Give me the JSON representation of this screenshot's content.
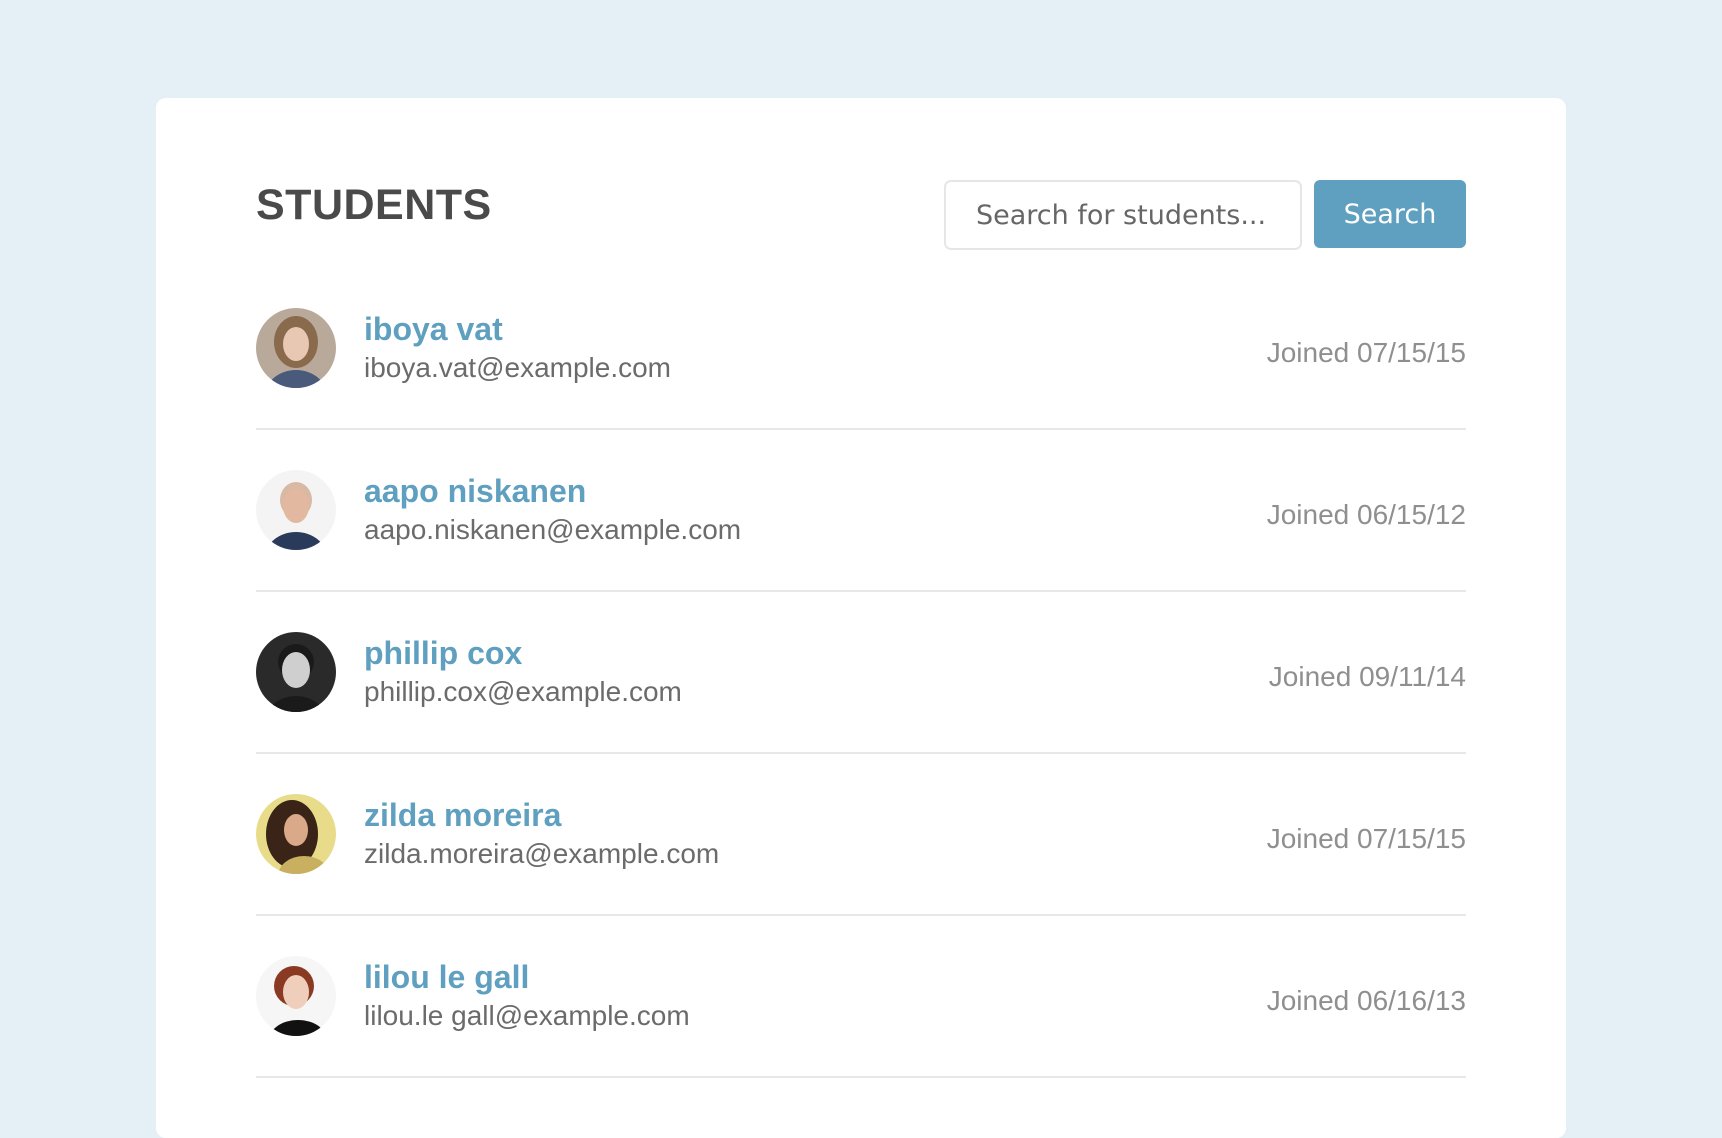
{
  "header": {
    "title": "STUDENTS",
    "search_placeholder": "Search for students...",
    "search_button_label": "Search"
  },
  "students": [
    {
      "name": "iboya vat",
      "email": "iboya.vat@example.com",
      "joined": "Joined 07/15/15",
      "avatar": {
        "bg": "#b9a99a",
        "skin": "#e8c8b2",
        "hair": "#8a6a4c",
        "shirt": "#4a5a7a"
      }
    },
    {
      "name": "aapo niskanen",
      "email": "aapo.niskanen@example.com",
      "joined": "Joined 06/15/12",
      "avatar": {
        "bg": "#f4f4f4",
        "skin": "#e2b9a0",
        "hair": "#d9b8a4",
        "shirt": "#2a3a5a"
      }
    },
    {
      "name": "phillip cox",
      "email": "phillip.cox@example.com",
      "joined": "Joined 09/11/14",
      "avatar": {
        "bg": "#2a2a2a",
        "skin": "#cfcfcf",
        "hair": "#1a1a1a",
        "shirt": "#1a1a1a"
      }
    },
    {
      "name": "zilda moreira",
      "email": "zilda.moreira@example.com",
      "joined": "Joined 07/15/15",
      "avatar": {
        "bg": "#e8dc8a",
        "skin": "#d9a98a",
        "hair": "#3a2418",
        "shirt": "#c8b060"
      }
    },
    {
      "name": "lilou le gall",
      "email": "lilou.le gall@example.com",
      "joined": "Joined 06/16/13",
      "avatar": {
        "bg": "#f6f6f6",
        "skin": "#efcfbc",
        "hair": "#8a3a22",
        "shirt": "#111111"
      }
    }
  ],
  "colors": {
    "page_background": "#e4eff6",
    "accent": "#5f9fbf",
    "title_text": "#4a4a4a",
    "muted_text": "#8f8f8f"
  }
}
